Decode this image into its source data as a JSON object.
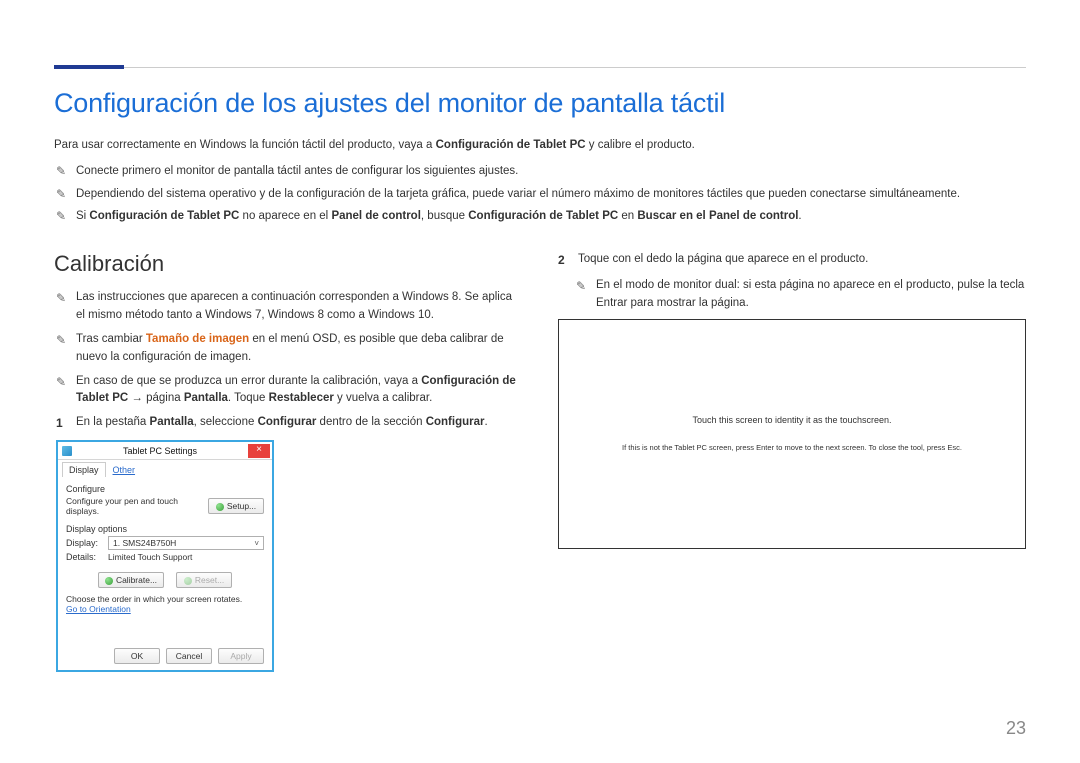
{
  "page_number": "23",
  "heading_main": "Configuración de los ajustes del monitor de pantalla táctil",
  "intro_pre": "Para usar correctamente en Windows la función táctil del producto, vaya a ",
  "intro_bold": "Configuración de Tablet PC",
  "intro_post": " y calibre el producto.",
  "notes_top": {
    "n1": "Conecte primero el monitor de pantalla táctil antes de configurar los siguientes ajustes.",
    "n2": "Dependiendo del sistema operativo y de la configuración de la tarjeta gráfica, puede variar el número máximo de monitores táctiles que pueden conectarse simultáneamente.",
    "n3_pre": "Si ",
    "n3_b1": "Configuración de Tablet PC",
    "n3_mid1": " no aparece en el ",
    "n3_b2": "Panel de control",
    "n3_mid2": ", busque ",
    "n3_b3": "Configuración de Tablet PC",
    "n3_mid3": " en ",
    "n3_b4": "Buscar en el Panel de control",
    "n3_post": "."
  },
  "heading_cal": "Calibración",
  "cal_notes": {
    "n1": "Las instrucciones que aparecen a continuación corresponden a Windows 8. Se aplica el mismo método tanto a Windows 7, Windows 8 como a Windows 10.",
    "n2_pre": "Tras cambiar ",
    "n2_h": "Tamaño de imagen",
    "n2_post": " en el menú OSD, es posible que deba calibrar de nuevo la configuración de imagen.",
    "n3_pre": "En caso de que se produzca un error durante la calibración, vaya a ",
    "n3_b1": "Configuración de Tablet PC",
    "n3_mid1": " → página ",
    "n3_b2": "Pantalla",
    "n3_mid2": ". Toque ",
    "n3_b3": "Restablecer",
    "n3_post": " y vuelva a calibrar."
  },
  "step1_num": "1",
  "step1_pre": "En la pestaña ",
  "step1_b1": "Pantalla",
  "step1_mid1": ", seleccione ",
  "step1_b2": "Configurar",
  "step1_mid2": " dentro de la sección ",
  "step1_b3": "Configurar",
  "step1_post": ".",
  "dialog": {
    "title": "Tablet PC Settings",
    "close": "×",
    "tab_display": "Display",
    "tab_other": "Other",
    "configure_label": "Configure",
    "configure_text": "Configure your pen and touch displays.",
    "setup_btn": "Setup...",
    "display_options_label": "Display options",
    "display_lbl": "Display:",
    "display_value": "1. SMS24B750H",
    "details_lbl": "Details:",
    "details_value": "Limited Touch Support",
    "calibrate_btn": "Calibrate...",
    "reset_btn": "Reset...",
    "rotate_text": "Choose the order in which your screen rotates.",
    "orientation_link": "Go to Orientation",
    "ok": "OK",
    "cancel": "Cancel",
    "apply": "Apply"
  },
  "step2_num": "2",
  "step2_text": "Toque con el dedo la página que aparece en el producto.",
  "step2_note": "En el modo de monitor dual: si esta página no aparece en el producto, pulse la tecla Entrar para mostrar la página.",
  "touchframe": {
    "main": "Touch this screen to identity it as the touchscreen.",
    "sub": "If this is not the Tablet PC screen, press Enter to move to the next screen. To close the tool, press Esc."
  }
}
